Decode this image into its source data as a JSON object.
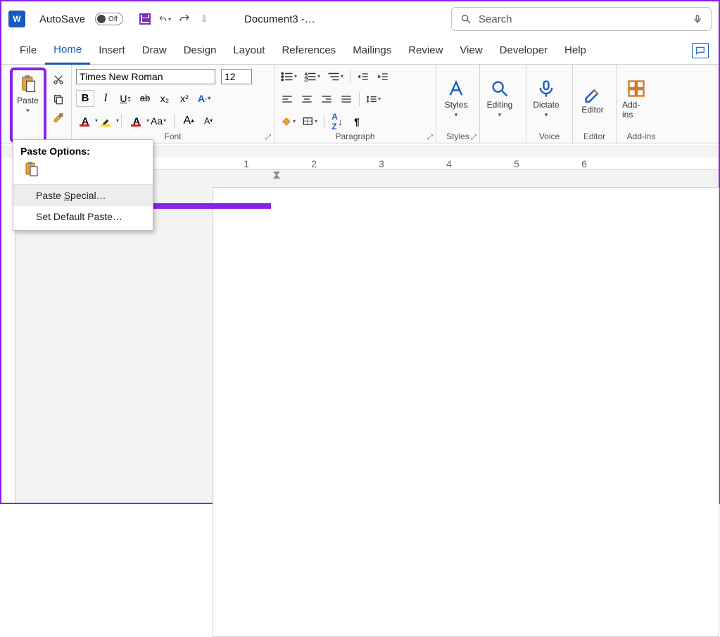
{
  "title": {
    "autosave_label": "AutoSave",
    "autosave_state": "Off",
    "doc_title": "Document3 -…"
  },
  "search": {
    "placeholder": "Search"
  },
  "tabs": {
    "file": "File",
    "home": "Home",
    "insert": "Insert",
    "draw": "Draw",
    "design": "Design",
    "layout": "Layout",
    "references": "References",
    "mailings": "Mailings",
    "review": "Review",
    "view": "View",
    "developer": "Developer",
    "help": "Help"
  },
  "ribbon": {
    "clipboard": {
      "paste": "Paste"
    },
    "font": {
      "name": "Times New Roman",
      "size": "12",
      "label": "Font",
      "bold": "B",
      "italic": "I",
      "underline": "U",
      "strike": "ab",
      "sub": "x₂",
      "sup": "x²",
      "effects": "A",
      "fontcolor": "A",
      "highlight": "✎",
      "case": "Aa",
      "grow": "A",
      "shrink": "A"
    },
    "paragraph": {
      "label": "Paragraph"
    },
    "styles": {
      "big": "Styles",
      "label": "Styles"
    },
    "editing": {
      "big": "Editing"
    },
    "dictate": {
      "big": "Dictate",
      "label": "Voice"
    },
    "editor": {
      "big": "Editor",
      "label": "Editor"
    },
    "addins": {
      "big": "Add-ins",
      "label": "Add-ins"
    }
  },
  "paste_menu": {
    "title": "Paste Options:",
    "special": "Paste Special…",
    "default": "Set Default Paste…"
  },
  "ruler": {
    "n1": "1",
    "n2": "2",
    "n3": "3",
    "n4": "4",
    "n5": "5",
    "n6": "6"
  }
}
